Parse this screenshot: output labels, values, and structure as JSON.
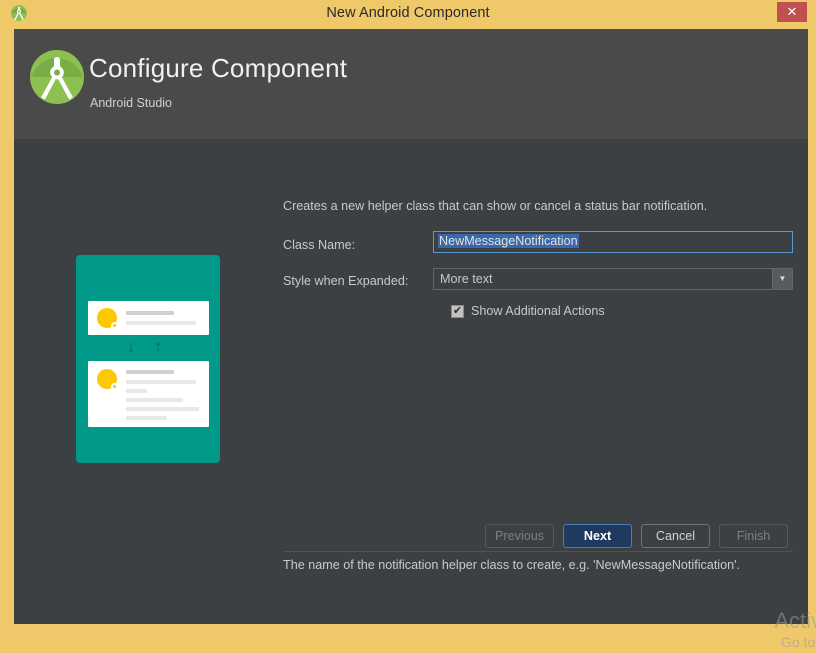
{
  "titlebar": {
    "title": "New Android Component",
    "icon": "android-studio-icon",
    "close_label": "✕"
  },
  "header": {
    "title": "Configure Component",
    "subtitle": "Android Studio",
    "logo": "android-studio-logo"
  },
  "content": {
    "description": "Creates a new helper class that can show or cancel a status bar notification.",
    "fields": {
      "class_name": {
        "label": "Class Name:",
        "value": "NewMessageNotification"
      },
      "style_when_expanded": {
        "label": "Style when Expanded:",
        "value": "More text",
        "arrow": "▼"
      },
      "show_additional_actions": {
        "label": "Show Additional Actions",
        "checked": true,
        "check_glyph": "✔"
      }
    },
    "help_text": "The name of the notification helper class to create, e.g. 'NewMessageNotification'.",
    "illustration": {
      "arrows": "↓ ↑"
    }
  },
  "buttons": {
    "previous": "Previous",
    "next": "Next",
    "cancel": "Cancel",
    "finish": "Finish"
  },
  "watermark": {
    "line1": "Activ",
    "line2": "Go to"
  },
  "colors": {
    "window_frame": "#efc86a",
    "dialog_bg": "#3c4043",
    "header_bg": "#4a4a4a",
    "accent_teal": "#00998a",
    "avatar_yellow": "#fdc800",
    "focus_blue": "#5b9bd5",
    "selection_blue": "#3a68a8",
    "close_red": "#c0504d",
    "default_button": "#1f3a5f"
  }
}
